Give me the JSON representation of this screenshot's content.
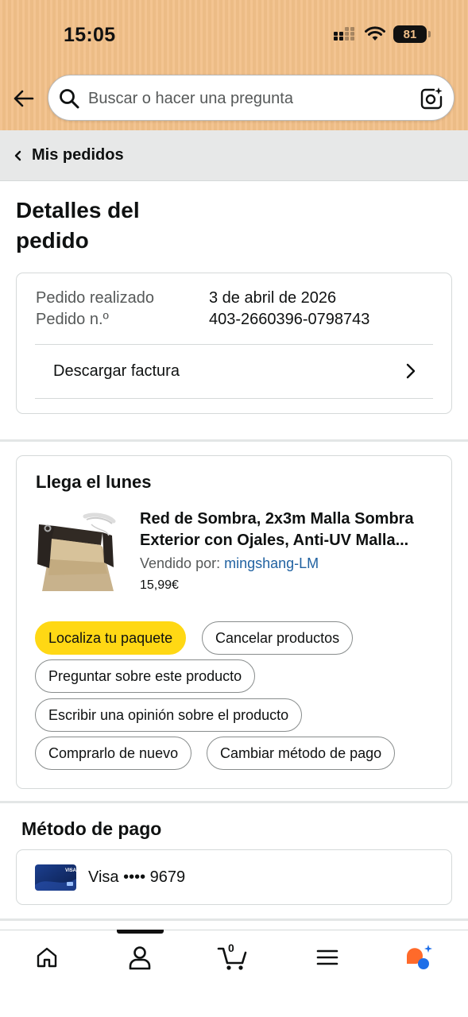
{
  "status_bar": {
    "time": "15:05",
    "battery": "81"
  },
  "search": {
    "placeholder": "Buscar o hacer una pregunta",
    "value": ""
  },
  "breadcrumb": {
    "label": "Mis pedidos"
  },
  "page": {
    "title_line1": "Detalles del",
    "title_line2": "pedido"
  },
  "order": {
    "placed_label": "Pedido realizado",
    "placed_value": "3 de abril de 2026",
    "number_label": "Pedido n.º",
    "number_value": "403-2660396-0798743",
    "invoice_label": "Descargar factura"
  },
  "delivery": {
    "arrival": "Llega el lunes",
    "product_title_line1": "Red de Sombra, 2x3m Malla Sombra",
    "product_title_line2": "Exterior con Ojales, Anti-UV Malla...",
    "seller_prefix": "Vendido por: ",
    "seller_name": "mingshang-LM",
    "price": "15,99€",
    "actions": {
      "track": "Localiza tu paquete",
      "cancel": "Cancelar productos",
      "ask": "Preguntar sobre este producto",
      "review": "Escribir una opinión sobre el producto",
      "buy_again": "Comprarlo de nuevo",
      "change_payment": "Cambiar método de pago"
    }
  },
  "payment": {
    "heading": "Método de pago",
    "card": "Visa •••• 9679"
  },
  "bottom_nav": {
    "cart_count": "0",
    "active": "account"
  },
  "colors": {
    "header_bg": "#f2c089",
    "primary_button": "#ffd814",
    "link": "#2162a1",
    "page_bg": "#ffffff",
    "breadcrumb_bg": "#e7e8e8"
  }
}
